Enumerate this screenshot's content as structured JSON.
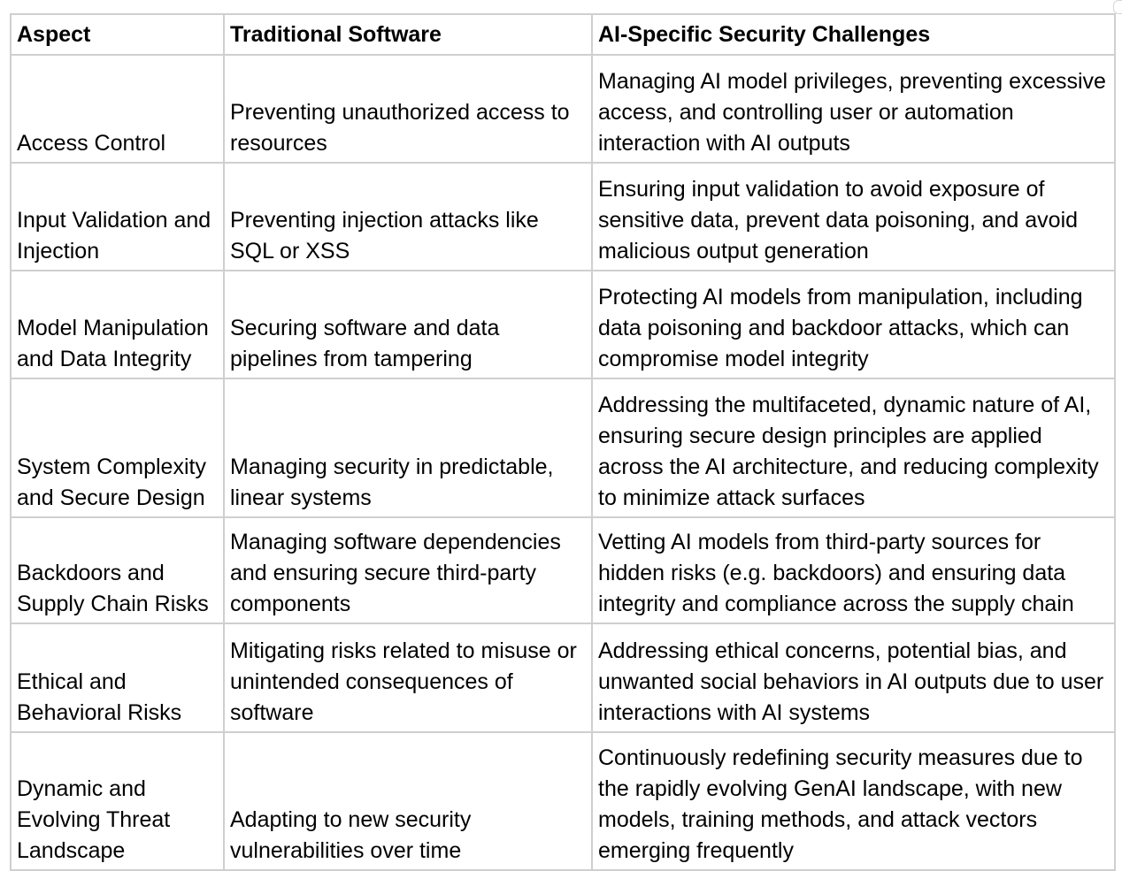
{
  "table": {
    "headers": [
      "Aspect",
      "Traditional Software",
      "AI-Specific Security Challenges"
    ],
    "rows": [
      [
        "Access Control",
        "Preventing unauthorized access to resources",
        "Managing AI model privileges, preventing excessive access, and controlling user or automation interaction with AI outputs"
      ],
      [
        "Input Validation and Injection",
        "Preventing injection attacks like SQL or XSS",
        "Ensuring input validation to avoid exposure of sensitive data, prevent data poisoning, and avoid malicious output generation"
      ],
      [
        "Model Manipulation and Data Integrity",
        "Securing software and data pipelines from tampering",
        "Protecting AI models from manipulation, including data poisoning and backdoor attacks, which can compromise model integrity"
      ],
      [
        "System Complexity and Secure Design",
        "Managing security in predictable, linear systems",
        "Addressing the multifaceted, dynamic nature of AI, ensuring secure design principles are applied across the AI architecture, and reducing complexity to minimize attack surfaces"
      ],
      [
        "Backdoors and Supply Chain Risks",
        "Managing software dependencies and ensuring secure third-party components",
        "Vetting AI models from third-party sources for hidden risks (e.g. backdoors) and ensuring data integrity and compliance across the supply chain"
      ],
      [
        "Ethical and Behavioral Risks",
        "Mitigating risks related to misuse or unintended consequences of software",
        "Addressing ethical concerns, potential bias, and unwanted social behaviors in AI outputs due to user interactions with AI systems"
      ],
      [
        "Dynamic and Evolving Threat Landscape",
        "Adapting to new security vulnerabilities over time",
        "Continuously redefining security measures due to the rapidly evolving GenAI landscape, with new models, training methods, and attack vectors emerging frequently"
      ]
    ]
  }
}
